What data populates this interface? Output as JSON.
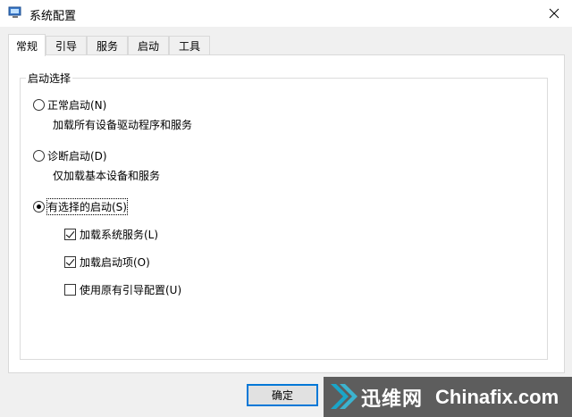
{
  "window": {
    "title": "系统配置"
  },
  "tabs": [
    {
      "label": "常规",
      "active": true
    },
    {
      "label": "引导",
      "active": false
    },
    {
      "label": "服务",
      "active": false
    },
    {
      "label": "启动",
      "active": false
    },
    {
      "label": "工具",
      "active": false
    }
  ],
  "startup_group": {
    "legend": "启动选择",
    "options": [
      {
        "label": "正常启动(N)",
        "description": "加载所有设备驱动程序和服务",
        "selected": false
      },
      {
        "label": "诊断启动(D)",
        "description": "仅加载基本设备和服务",
        "selected": false
      },
      {
        "label": "有选择的启动(S)",
        "selected": true
      }
    ],
    "selective": [
      {
        "label": "加载系统服务(L)",
        "checked": true
      },
      {
        "label": "加载启动项(O)",
        "checked": true
      },
      {
        "label": "使用原有引导配置(U)",
        "checked": false
      }
    ]
  },
  "buttons": {
    "ok": "确定"
  },
  "watermark": {
    "brand": "迅维网",
    "site": "Chinafix.com"
  },
  "icons": {
    "app": "app-window-icon",
    "close": "close-icon",
    "watermark_logo": "chevron-logo-icon"
  },
  "colors": {
    "accent": "#0078d7",
    "logo": "#1aa5c8"
  }
}
